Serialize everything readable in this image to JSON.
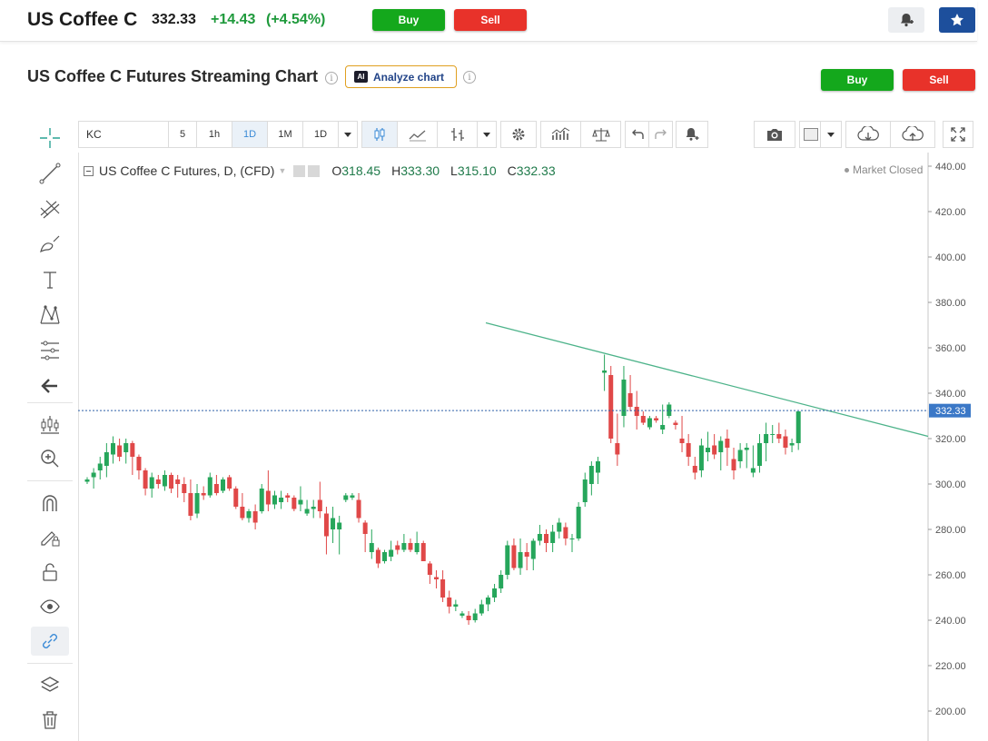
{
  "header": {
    "symbol_title": "US Coffee C",
    "price": "332.33",
    "change": "+14.43",
    "change_pct": "(+4.54%)",
    "buy_label": "Buy",
    "sell_label": "Sell"
  },
  "subheader": {
    "title": "US Coffee C Futures Streaming Chart",
    "analyze_label": "Analyze chart",
    "ai_badge": "AI",
    "buy_label": "Buy",
    "sell_label": "Sell"
  },
  "toolbar": {
    "symbol": "KC",
    "intervals": [
      "5",
      "1h",
      "1D",
      "1M",
      "1D"
    ],
    "selected_interval": "1D"
  },
  "legend": {
    "title": "US Coffee C Futures, D, (CFD)",
    "open_label": "O",
    "open": "318.45",
    "high_label": "H",
    "high": "333.30",
    "low_label": "L",
    "low": "315.10",
    "close_label": "C",
    "close": "332.33",
    "market_status": "Market Closed"
  },
  "colors": {
    "up": "#26a65b",
    "down": "#e04848",
    "buy": "#14a81c",
    "sell": "#e8322a",
    "trendline": "#4db38a",
    "price_tag": "#3b78c7"
  },
  "chart_data": {
    "type": "candlestick",
    "y_ticks": [
      "440.00",
      "420.00",
      "400.00",
      "380.00",
      "360.00",
      "340.00",
      "320.00",
      "300.00",
      "280.00",
      "260.00",
      "240.00",
      "220.00",
      "200.00"
    ],
    "ylim": [
      190,
      444
    ],
    "last_price_label": "332.33",
    "last_price": 332.33,
    "trendline": [
      [
        0,
        371
      ],
      [
        1,
        321
      ]
    ],
    "candles": [
      [
        301,
        303,
        300,
        302
      ],
      [
        303,
        307,
        298,
        305
      ],
      [
        306,
        312,
        302,
        309
      ],
      [
        308,
        318,
        303,
        314
      ],
      [
        313,
        321,
        309,
        318
      ],
      [
        317,
        320,
        310,
        312
      ],
      [
        314,
        320,
        309,
        318
      ],
      [
        318,
        319,
        304,
        312
      ],
      [
        312,
        313,
        302,
        306
      ],
      [
        306,
        307,
        295,
        298
      ],
      [
        298,
        305,
        294,
        303
      ],
      [
        302,
        304,
        298,
        300
      ],
      [
        299,
        306,
        297,
        304
      ],
      [
        304,
        305,
        296,
        298
      ],
      [
        302,
        304,
        294,
        300
      ],
      [
        300,
        303,
        292,
        296
      ],
      [
        296,
        302,
        284,
        286
      ],
      [
        287,
        300,
        285,
        296
      ],
      [
        296,
        299,
        293,
        295
      ],
      [
        295,
        305,
        294,
        303
      ],
      [
        300,
        304,
        295,
        296
      ],
      [
        297,
        303,
        296,
        302
      ],
      [
        303,
        304,
        297,
        298
      ],
      [
        298,
        299,
        289,
        290
      ],
      [
        290,
        296,
        284,
        285
      ],
      [
        285,
        289,
        283,
        288
      ],
      [
        288,
        291,
        280,
        283
      ],
      [
        288,
        300,
        287,
        298
      ],
      [
        297,
        306,
        288,
        291
      ],
      [
        291,
        297,
        289,
        295
      ],
      [
        292,
        297,
        289,
        294
      ],
      [
        295,
        296,
        292,
        294
      ],
      [
        294,
        295,
        288,
        289
      ],
      [
        291,
        299,
        288,
        293
      ],
      [
        287,
        293,
        286,
        289
      ],
      [
        289,
        293,
        285,
        290
      ],
      [
        293,
        301,
        285,
        288
      ],
      [
        287,
        290,
        269,
        277
      ],
      [
        280,
        290,
        274,
        285
      ],
      [
        280,
        286,
        269,
        283
      ],
      [
        293,
        296,
        292,
        295
      ],
      [
        294,
        296,
        293,
        295
      ],
      [
        293,
        296,
        283,
        285
      ],
      [
        283,
        284,
        270,
        278
      ],
      [
        270,
        280,
        267,
        274
      ],
      [
        271,
        272,
        263,
        265
      ],
      [
        266,
        271,
        265,
        270
      ],
      [
        268,
        275,
        266,
        271
      ],
      [
        273,
        275,
        269,
        271
      ],
      [
        271,
        278,
        270,
        274
      ],
      [
        274,
        276,
        270,
        271
      ],
      [
        270,
        279,
        269,
        274
      ],
      [
        274,
        275,
        270,
        266
      ],
      [
        265,
        266,
        256,
        260
      ],
      [
        259,
        262,
        254,
        258
      ],
      [
        258,
        262,
        248,
        250
      ],
      [
        250,
        253,
        243,
        246
      ],
      [
        246,
        249,
        244,
        247
      ],
      [
        242,
        244,
        241,
        243
      ],
      [
        242,
        244,
        238,
        240
      ],
      [
        240,
        245,
        239,
        243
      ],
      [
        243,
        249,
        242,
        247
      ],
      [
        247,
        251,
        244,
        250
      ],
      [
        250,
        256,
        248,
        254
      ],
      [
        254,
        262,
        252,
        260
      ],
      [
        260,
        275,
        258,
        273
      ],
      [
        273,
        276,
        262,
        263
      ],
      [
        263,
        276,
        260,
        270
      ],
      [
        270,
        274,
        262,
        268
      ],
      [
        267,
        276,
        262,
        275
      ],
      [
        275,
        282,
        273,
        278
      ],
      [
        278,
        280,
        270,
        274
      ],
      [
        274,
        282,
        270,
        279
      ],
      [
        279,
        285,
        276,
        283
      ],
      [
        281,
        283,
        273,
        276
      ],
      [
        276,
        278,
        270,
        276
      ],
      [
        276,
        292,
        275,
        290
      ],
      [
        292,
        305,
        290,
        302
      ],
      [
        300,
        310,
        295,
        308
      ],
      [
        305,
        312,
        300,
        310
      ],
      [
        349,
        357,
        341,
        350
      ],
      [
        348,
        352,
        318,
        320
      ],
      [
        318,
        331,
        308,
        313
      ],
      [
        330,
        352,
        325,
        346
      ],
      [
        340,
        348,
        332,
        334
      ],
      [
        334,
        341,
        324,
        330
      ],
      [
        330,
        332,
        326,
        327
      ],
      [
        325,
        330,
        324,
        329
      ],
      [
        329,
        330,
        327,
        328
      ],
      [
        324,
        335,
        322,
        326
      ],
      [
        330,
        336,
        329,
        335
      ],
      [
        327,
        328,
        324,
        326
      ],
      [
        320,
        330,
        314,
        318
      ],
      [
        318,
        322,
        308,
        312
      ],
      [
        308,
        312,
        302,
        305
      ],
      [
        306,
        320,
        303,
        317
      ],
      [
        314,
        323,
        310,
        316
      ],
      [
        317,
        322,
        311,
        313
      ],
      [
        314,
        321,
        306,
        319
      ],
      [
        320,
        324,
        308,
        316
      ],
      [
        311,
        316,
        302,
        306
      ],
      [
        310,
        318,
        307,
        315
      ],
      [
        315,
        318,
        307,
        316
      ],
      [
        305,
        317,
        303,
        307
      ],
      [
        308,
        322,
        305,
        318
      ],
      [
        318,
        327,
        310,
        322
      ],
      [
        322,
        326,
        318,
        322
      ],
      [
        322,
        327,
        318,
        320
      ],
      [
        321,
        324,
        313,
        316
      ],
      [
        317,
        320,
        314,
        318
      ],
      [
        318,
        332,
        315,
        332
      ]
    ]
  }
}
